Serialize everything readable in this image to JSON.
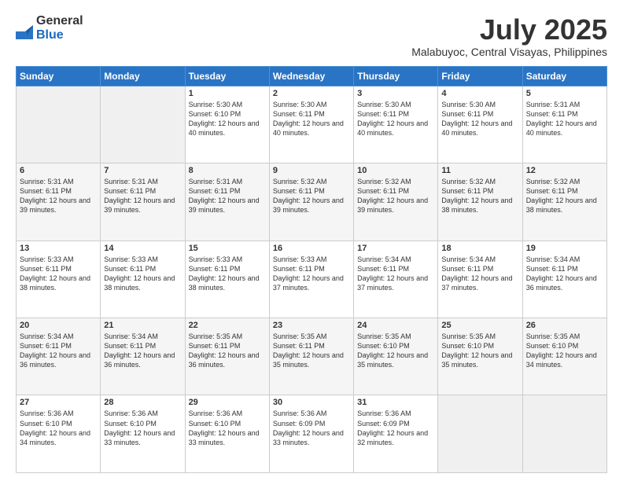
{
  "logo": {
    "general": "General",
    "blue": "Blue"
  },
  "title": "July 2025",
  "subtitle": "Malabuyoc, Central Visayas, Philippines",
  "days_of_week": [
    "Sunday",
    "Monday",
    "Tuesday",
    "Wednesday",
    "Thursday",
    "Friday",
    "Saturday"
  ],
  "weeks": [
    [
      {
        "day": "",
        "info": ""
      },
      {
        "day": "",
        "info": ""
      },
      {
        "day": "1",
        "info": "Sunrise: 5:30 AM\nSunset: 6:10 PM\nDaylight: 12 hours and 40 minutes."
      },
      {
        "day": "2",
        "info": "Sunrise: 5:30 AM\nSunset: 6:11 PM\nDaylight: 12 hours and 40 minutes."
      },
      {
        "day": "3",
        "info": "Sunrise: 5:30 AM\nSunset: 6:11 PM\nDaylight: 12 hours and 40 minutes."
      },
      {
        "day": "4",
        "info": "Sunrise: 5:30 AM\nSunset: 6:11 PM\nDaylight: 12 hours and 40 minutes."
      },
      {
        "day": "5",
        "info": "Sunrise: 5:31 AM\nSunset: 6:11 PM\nDaylight: 12 hours and 40 minutes."
      }
    ],
    [
      {
        "day": "6",
        "info": "Sunrise: 5:31 AM\nSunset: 6:11 PM\nDaylight: 12 hours and 39 minutes."
      },
      {
        "day": "7",
        "info": "Sunrise: 5:31 AM\nSunset: 6:11 PM\nDaylight: 12 hours and 39 minutes."
      },
      {
        "day": "8",
        "info": "Sunrise: 5:31 AM\nSunset: 6:11 PM\nDaylight: 12 hours and 39 minutes."
      },
      {
        "day": "9",
        "info": "Sunrise: 5:32 AM\nSunset: 6:11 PM\nDaylight: 12 hours and 39 minutes."
      },
      {
        "day": "10",
        "info": "Sunrise: 5:32 AM\nSunset: 6:11 PM\nDaylight: 12 hours and 39 minutes."
      },
      {
        "day": "11",
        "info": "Sunrise: 5:32 AM\nSunset: 6:11 PM\nDaylight: 12 hours and 38 minutes."
      },
      {
        "day": "12",
        "info": "Sunrise: 5:32 AM\nSunset: 6:11 PM\nDaylight: 12 hours and 38 minutes."
      }
    ],
    [
      {
        "day": "13",
        "info": "Sunrise: 5:33 AM\nSunset: 6:11 PM\nDaylight: 12 hours and 38 minutes."
      },
      {
        "day": "14",
        "info": "Sunrise: 5:33 AM\nSunset: 6:11 PM\nDaylight: 12 hours and 38 minutes."
      },
      {
        "day": "15",
        "info": "Sunrise: 5:33 AM\nSunset: 6:11 PM\nDaylight: 12 hours and 38 minutes."
      },
      {
        "day": "16",
        "info": "Sunrise: 5:33 AM\nSunset: 6:11 PM\nDaylight: 12 hours and 37 minutes."
      },
      {
        "day": "17",
        "info": "Sunrise: 5:34 AM\nSunset: 6:11 PM\nDaylight: 12 hours and 37 minutes."
      },
      {
        "day": "18",
        "info": "Sunrise: 5:34 AM\nSunset: 6:11 PM\nDaylight: 12 hours and 37 minutes."
      },
      {
        "day": "19",
        "info": "Sunrise: 5:34 AM\nSunset: 6:11 PM\nDaylight: 12 hours and 36 minutes."
      }
    ],
    [
      {
        "day": "20",
        "info": "Sunrise: 5:34 AM\nSunset: 6:11 PM\nDaylight: 12 hours and 36 minutes."
      },
      {
        "day": "21",
        "info": "Sunrise: 5:34 AM\nSunset: 6:11 PM\nDaylight: 12 hours and 36 minutes."
      },
      {
        "day": "22",
        "info": "Sunrise: 5:35 AM\nSunset: 6:11 PM\nDaylight: 12 hours and 36 minutes."
      },
      {
        "day": "23",
        "info": "Sunrise: 5:35 AM\nSunset: 6:11 PM\nDaylight: 12 hours and 35 minutes."
      },
      {
        "day": "24",
        "info": "Sunrise: 5:35 AM\nSunset: 6:10 PM\nDaylight: 12 hours and 35 minutes."
      },
      {
        "day": "25",
        "info": "Sunrise: 5:35 AM\nSunset: 6:10 PM\nDaylight: 12 hours and 35 minutes."
      },
      {
        "day": "26",
        "info": "Sunrise: 5:35 AM\nSunset: 6:10 PM\nDaylight: 12 hours and 34 minutes."
      }
    ],
    [
      {
        "day": "27",
        "info": "Sunrise: 5:36 AM\nSunset: 6:10 PM\nDaylight: 12 hours and 34 minutes."
      },
      {
        "day": "28",
        "info": "Sunrise: 5:36 AM\nSunset: 6:10 PM\nDaylight: 12 hours and 33 minutes."
      },
      {
        "day": "29",
        "info": "Sunrise: 5:36 AM\nSunset: 6:10 PM\nDaylight: 12 hours and 33 minutes."
      },
      {
        "day": "30",
        "info": "Sunrise: 5:36 AM\nSunset: 6:09 PM\nDaylight: 12 hours and 33 minutes."
      },
      {
        "day": "31",
        "info": "Sunrise: 5:36 AM\nSunset: 6:09 PM\nDaylight: 12 hours and 32 minutes."
      },
      {
        "day": "",
        "info": ""
      },
      {
        "day": "",
        "info": ""
      }
    ]
  ]
}
